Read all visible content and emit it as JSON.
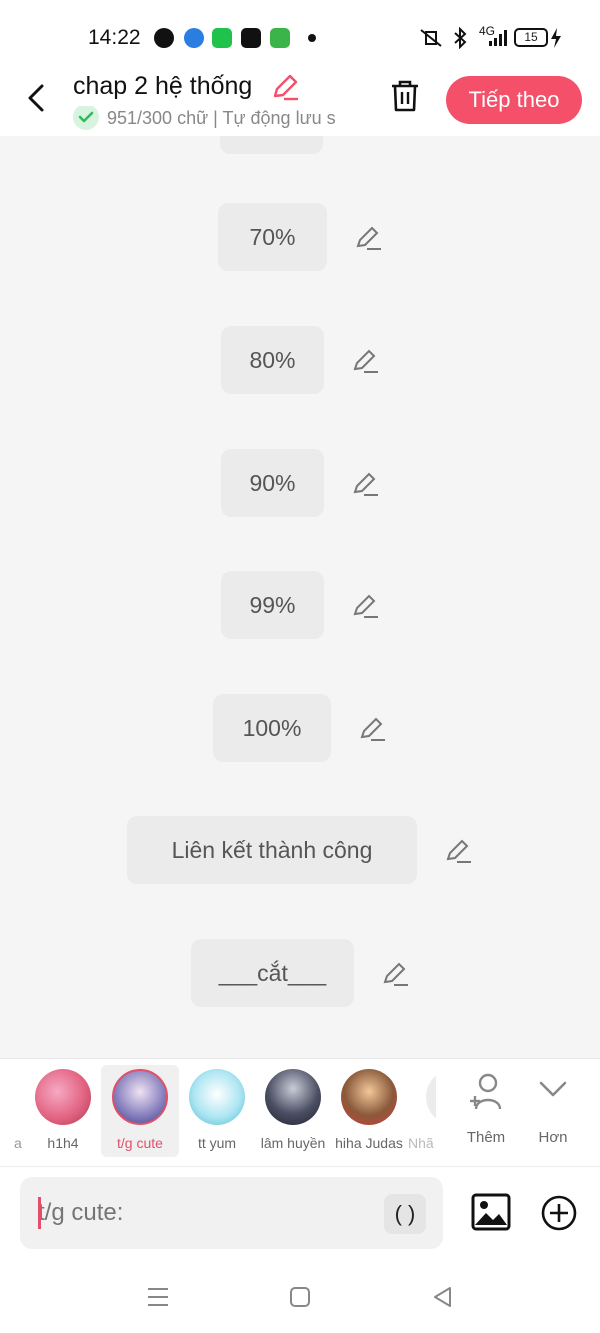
{
  "status": {
    "time": "14:22",
    "network": "4G",
    "battery": "15"
  },
  "header": {
    "title": "chap 2 hệ thống",
    "subtitle": "951/300 chữ | Tự động lưu s",
    "next_label": "Tiếp theo"
  },
  "blocks": [
    {
      "text": "70%"
    },
    {
      "text": "80%"
    },
    {
      "text": "90%"
    },
    {
      "text": "99%"
    },
    {
      "text": "100%"
    },
    {
      "text": "Liên kết thành công"
    },
    {
      "text": "___cắt___"
    }
  ],
  "characters": [
    {
      "name": "h1h4"
    },
    {
      "name": "t/g cute",
      "selected": true
    },
    {
      "name": "tt yum"
    },
    {
      "name": "lâm huyền"
    },
    {
      "name": "hiha Judas"
    },
    {
      "name": "Nhã"
    }
  ],
  "character_bar": {
    "partial_name": "a",
    "more_label": "Thêm",
    "expand_label": "Hơn"
  },
  "composer": {
    "placeholder": "t/g cute:",
    "paren_label": "( )"
  },
  "colors": {
    "accent": "#f4506a",
    "check_bg": "#d8f3df",
    "check_mark": "#2ebd59"
  }
}
